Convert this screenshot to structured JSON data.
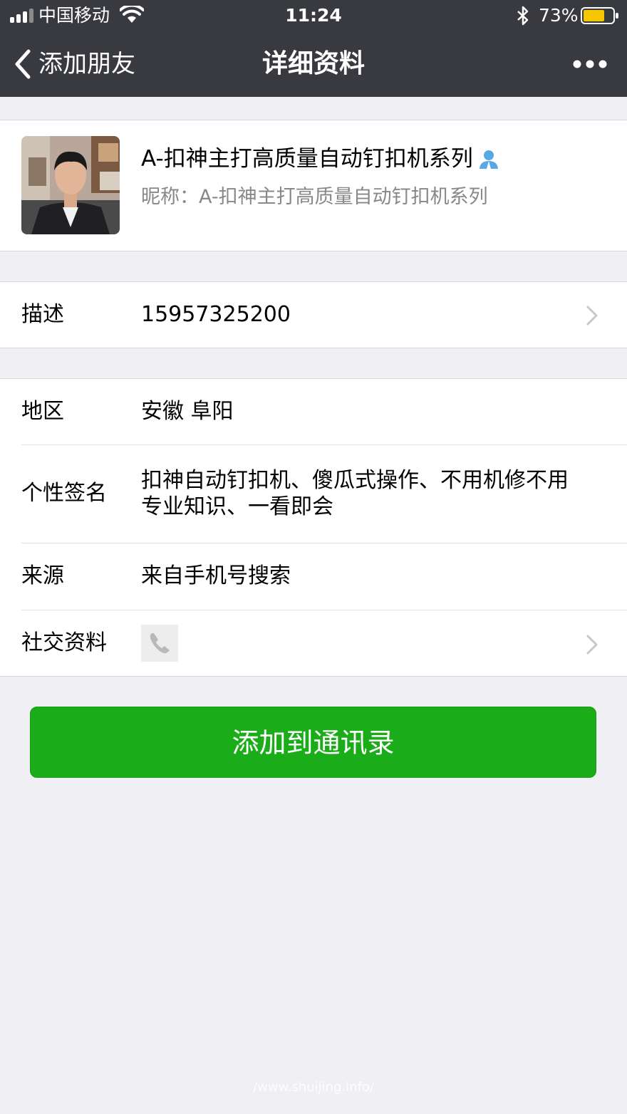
{
  "status_bar": {
    "carrier": "中国移动",
    "time": "11:24",
    "battery_percent": "73%"
  },
  "nav": {
    "back_label": "添加朋友",
    "title": "详细资料"
  },
  "profile": {
    "name": "A-扣神主打高质量自动钉扣机系列",
    "nickname": "昵称：A-扣神主打高质量自动钉扣机系列"
  },
  "description": {
    "label": "描述",
    "value": "15957325200"
  },
  "info": {
    "region_label": "地区",
    "region_value": "安徽 阜阳",
    "signature_label": "个性签名",
    "signature_line1": "扣神自动钉扣机、傻瓜式操作、不用机修不用",
    "signature_line2": "专业知识、一看即会",
    "source_label": "来源",
    "source_value": "来自手机号搜索",
    "social_label": "社交资料"
  },
  "add_button": "添加到通讯录",
  "watermark": "/www.shuijing.info/",
  "colors": {
    "nav_bg": "#393a3f",
    "page_bg": "#efeff4",
    "button_green": "#1aad19",
    "battery_yellow": "#f6c700"
  }
}
